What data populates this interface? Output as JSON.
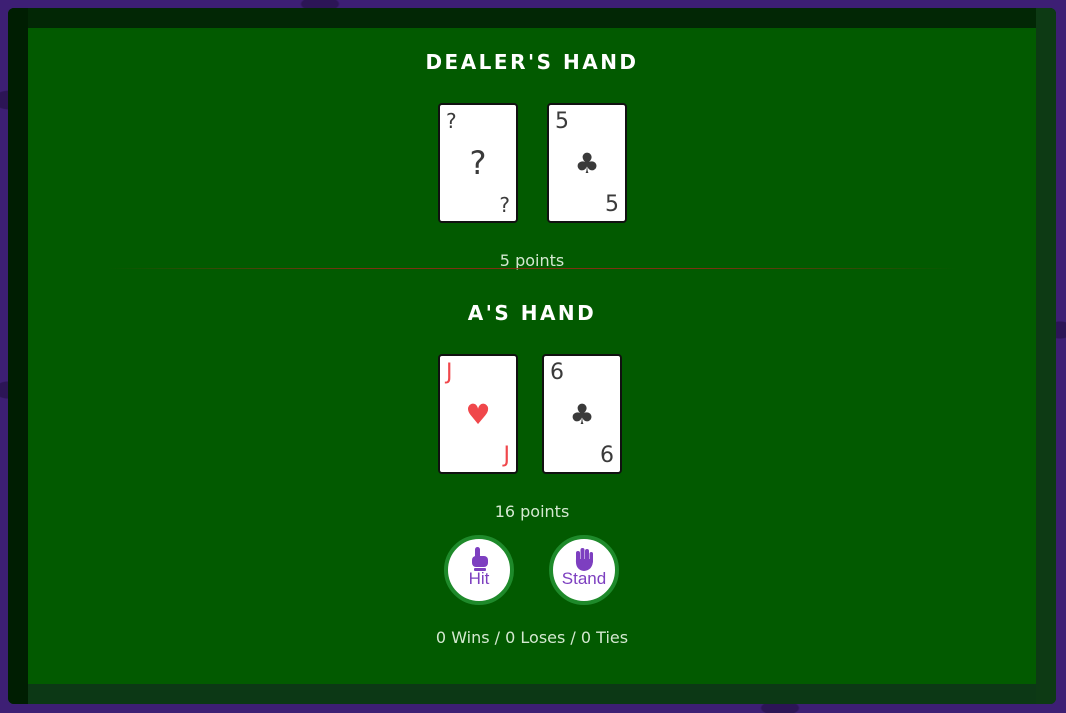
{
  "dealer": {
    "title": "DEALER'S HAND",
    "points": "5 points",
    "cards": [
      {
        "rank": "?",
        "suit": "?",
        "color": "black",
        "hidden": true
      },
      {
        "rank": "5",
        "suit": "♣",
        "color": "black",
        "hidden": false
      }
    ]
  },
  "player": {
    "title": "A'S HAND",
    "points": "16 points",
    "cards": [
      {
        "rank": "J",
        "suit": "♥",
        "color": "red",
        "hidden": false
      },
      {
        "rank": "6",
        "suit": "♣",
        "color": "black",
        "hidden": false
      }
    ]
  },
  "actions": {
    "hit_label": "Hit",
    "hit_icon": "pointing-hand-icon",
    "stand_label": "Stand",
    "stand_icon": "raised-hand-icon"
  },
  "score": "0 Wins / 0 Loses / 0 Ties",
  "colors": {
    "felt": "#025a00",
    "card_red": "#f0474b",
    "card_black": "#3a3a3a",
    "button_text": "#7d3fc0",
    "button_ring": "#1e8a2a"
  }
}
